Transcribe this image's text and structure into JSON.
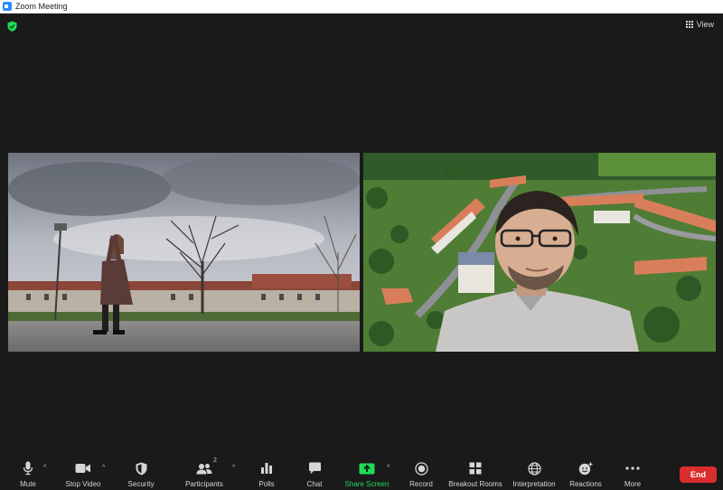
{
  "window": {
    "title": "Zoom Meeting"
  },
  "header": {
    "view_label": "View"
  },
  "toolbar": {
    "mute": "Mute",
    "stop_video": "Stop Video",
    "security": "Security",
    "participants": "Participants",
    "participants_count": "2",
    "polls": "Polls",
    "chat": "Chat",
    "share_screen": "Share Screen",
    "record": "Record",
    "breakout_rooms": "Breakout Rooms",
    "interpretation": "Interpretation",
    "reactions": "Reactions",
    "more": "More",
    "end": "End"
  },
  "icons": [
    "zoom-app-icon",
    "shield-icon",
    "grid-view-icon",
    "microphone-icon",
    "video-camera-icon",
    "security-shield-icon",
    "participants-icon",
    "polls-icon",
    "chat-icon",
    "share-screen-icon",
    "record-icon",
    "breakout-rooms-icon",
    "globe-icon",
    "reactions-icon",
    "more-icon"
  ],
  "colors": {
    "background": "#1a1a1a",
    "share_accent": "#23d959",
    "end_button": "#d92e2e",
    "security_shield": "#23d959"
  }
}
